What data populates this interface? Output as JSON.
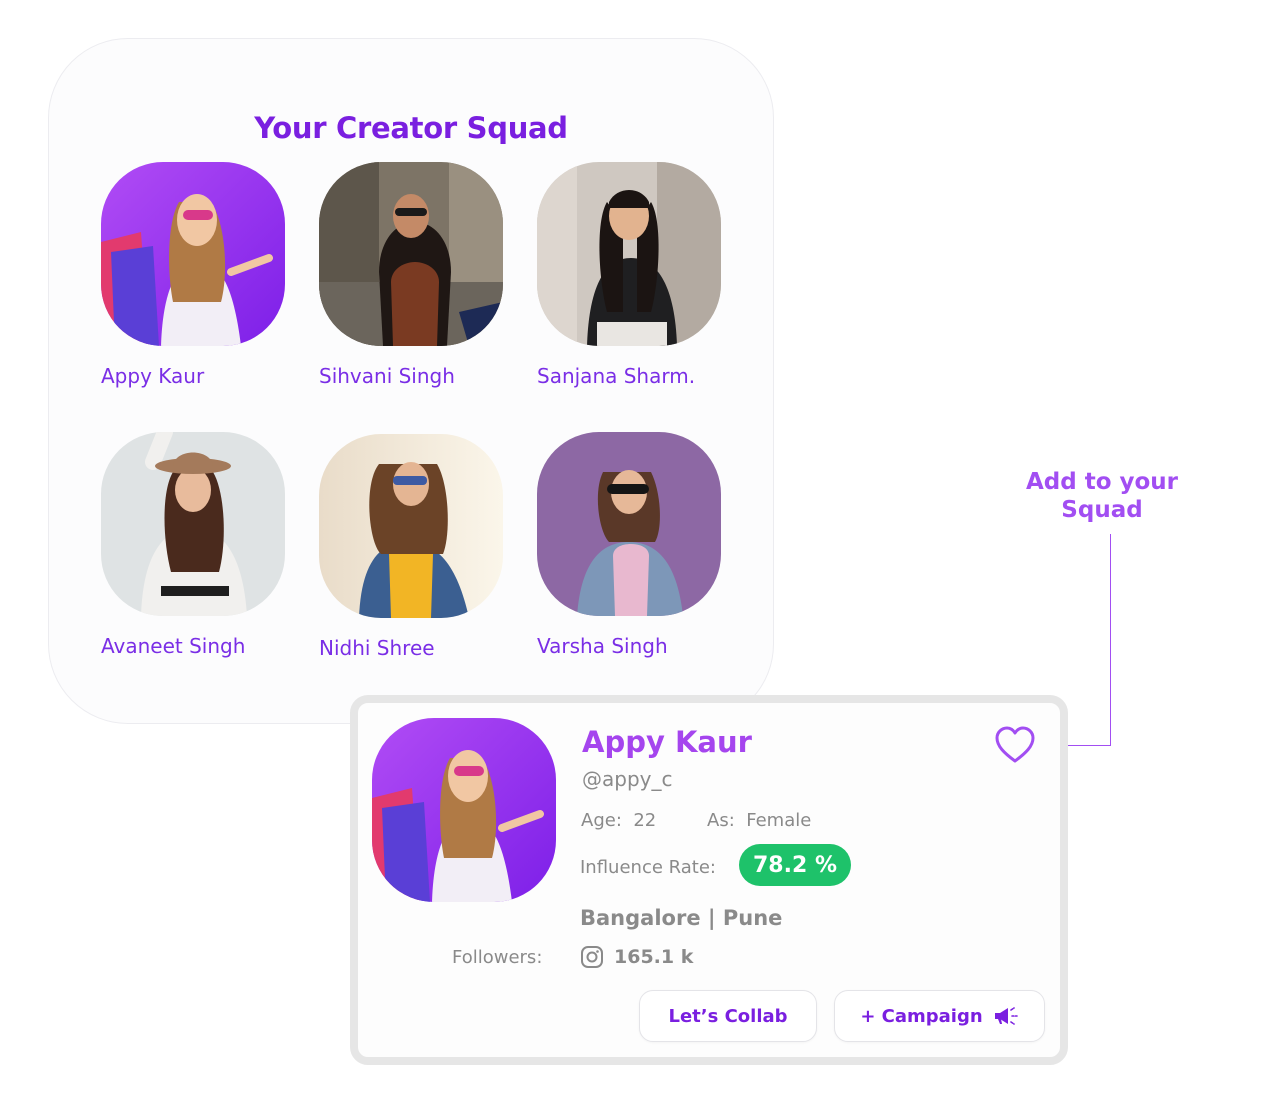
{
  "squad": {
    "title": "Your Creator Squad",
    "creators": [
      {
        "name": "Appy Kaur",
        "photo": "woman with shopping bags on purple background"
      },
      {
        "name": "Sihvani Singh",
        "photo": "woman in sunglasses sitting outdoors"
      },
      {
        "name": "Sanjana Sharm.",
        "photo": "woman with long dark hair in black top"
      },
      {
        "name": "Avaneet Singh",
        "photo": "woman in hat and white sweater"
      },
      {
        "name": "Nidhi Shree",
        "photo": "woman in sunglasses and denim jacket outdoors"
      },
      {
        "name": "Varsha Singh",
        "photo": "woman in sunglasses on purple background"
      }
    ]
  },
  "annotation": {
    "line1": "Add to your",
    "line2": "Squad"
  },
  "profile": {
    "name": "Appy Kaur",
    "handle": "@appy_c",
    "age_label": "Age:",
    "age": "22",
    "gender_label": "As:",
    "gender": "Female",
    "influence_label": "Influence Rate:",
    "influence_rate": "78.2 %",
    "location": "Bangalore | Pune",
    "followers_label": "Followers:",
    "followers": "165.1 k",
    "collab_button": "Let’s Collab",
    "campaign_button": "+ Campaign"
  },
  "colors": {
    "brand_purple": "#7a1fe0",
    "accent_purple": "#a545ee",
    "rate_green": "#1ec26a",
    "muted_text": "#8a8a8a"
  },
  "icons": [
    "heart-icon",
    "instagram-icon",
    "megaphone-icon"
  ]
}
